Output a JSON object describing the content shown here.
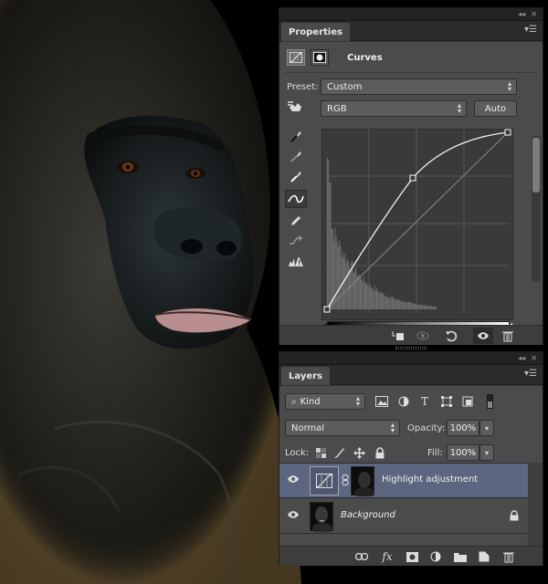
{
  "properties": {
    "tab_label": "Properties",
    "adjustment_title": "Curves",
    "preset_label": "Preset:",
    "preset_value": "Custom",
    "channel_value": "RGB",
    "auto_label": "Auto",
    "icons": {
      "adjustment": "curves-adjustment-icon",
      "mask": "layer-mask-icon",
      "on_image": "on-image-adjustment-icon",
      "black_point": "black-point-eyedropper-icon",
      "gray_point": "gray-point-eyedropper-icon",
      "white_point": "white-point-eyedropper-icon",
      "edit_points": "edit-points-curve-icon",
      "pencil": "pencil-draw-curve-icon",
      "smooth": "smooth-curve-icon",
      "clipping_warning": "clipping-warning-icon"
    },
    "footer_icons": [
      "clip-to-layer-icon",
      "view-previous-state-icon",
      "reset-icon",
      "visibility-eye-icon",
      "trash-icon"
    ]
  },
  "layers": {
    "tab_label": "Layers",
    "kind_value": "Kind",
    "blend_mode": "Normal",
    "opacity_label": "Opacity:",
    "opacity_value": "100%",
    "lock_label": "Lock:",
    "fill_label": "Fill:",
    "fill_value": "100%",
    "filter_icons": [
      "pixel-layer-filter-icon",
      "adjustment-layer-filter-icon",
      "type-layer-filter-icon",
      "shape-layer-filter-icon",
      "smart-object-filter-icon",
      "filter-toggle-icon"
    ],
    "lock_icons": [
      "lock-transparent-pixels-icon",
      "lock-image-pixels-icon",
      "lock-position-icon",
      "lock-all-icon"
    ],
    "items": [
      {
        "name": "Highlight adjustment",
        "selected": true,
        "visible": true,
        "italic": false
      },
      {
        "name": "Background",
        "selected": false,
        "visible": true,
        "italic": true,
        "locked": true
      }
    ],
    "footer_icons": [
      "link-layers-icon",
      "layer-style-fx-icon",
      "add-mask-icon",
      "new-adjustment-layer-icon",
      "new-group-icon",
      "new-layer-icon",
      "delete-layer-icon"
    ]
  },
  "colors": {
    "panel_bg": "#4b4b4b",
    "selected_layer": "#5d6680",
    "curve_bg": "#3a3a3a"
  }
}
